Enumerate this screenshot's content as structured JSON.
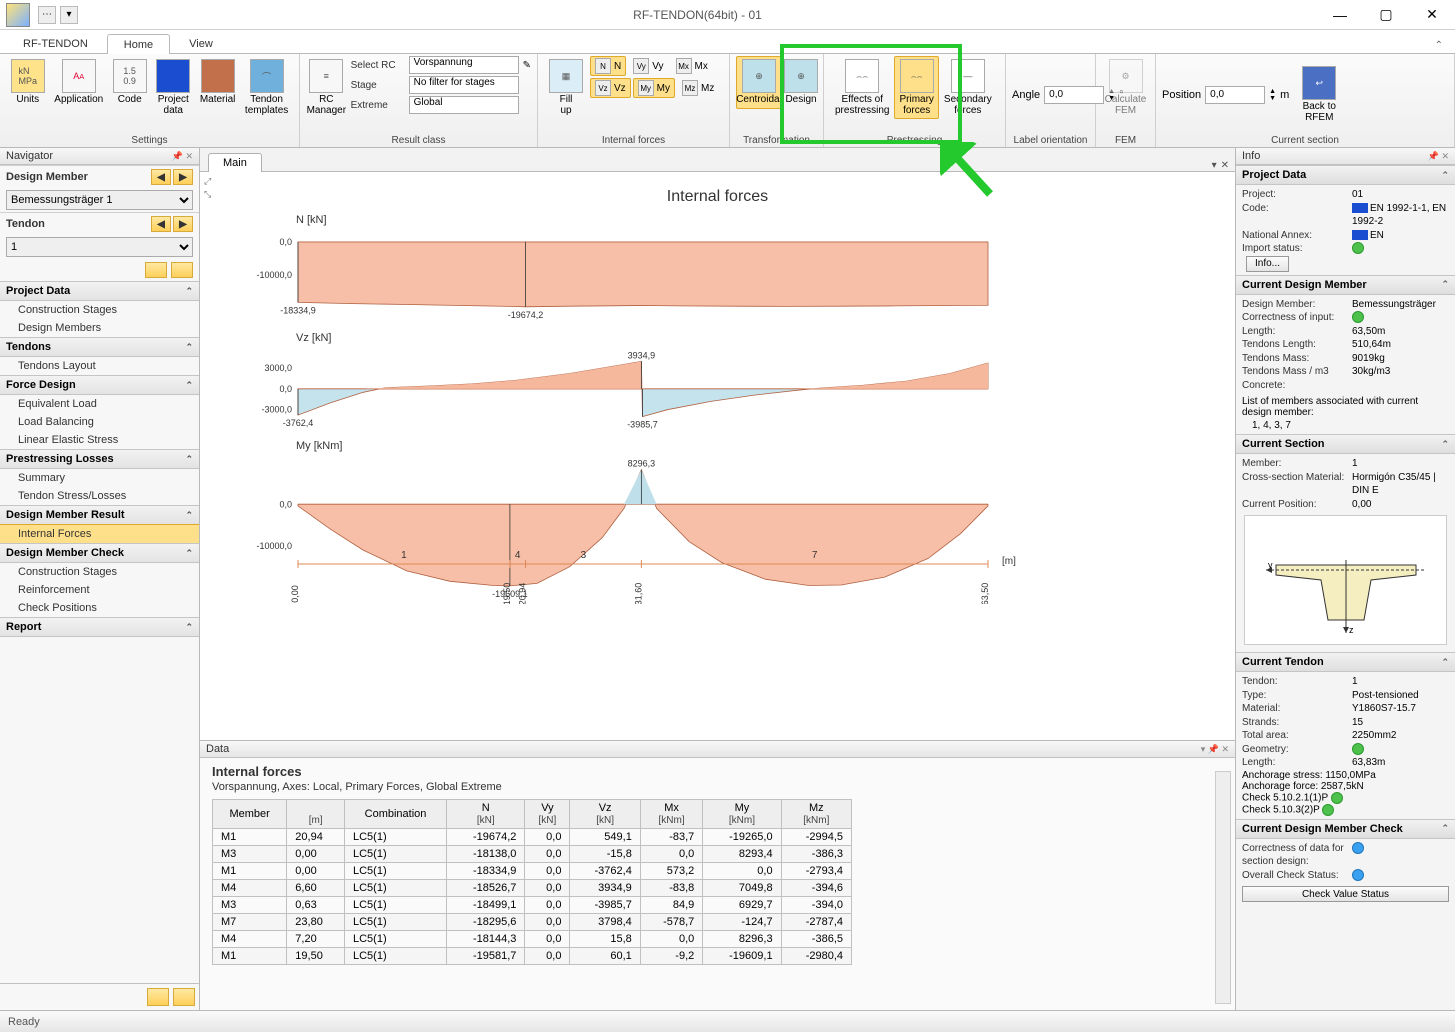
{
  "window": {
    "title": "RF-TENDON(64bit) - 01"
  },
  "tabs": {
    "context": "RF-TENDON",
    "items": [
      "Home",
      "View"
    ],
    "active": 0
  },
  "ribbon": {
    "settings": {
      "label": "Settings",
      "items": [
        {
          "name": "units",
          "label": "Units"
        },
        {
          "name": "application",
          "label": "Application"
        },
        {
          "name": "code",
          "label": "Code"
        },
        {
          "name": "project-data",
          "label": "Project\ndata"
        },
        {
          "name": "material",
          "label": "Material"
        },
        {
          "name": "tendon-templates",
          "label": "Tendon\ntemplates"
        }
      ]
    },
    "resultclass": {
      "label": "Result class",
      "rc_manager": "RC\nManager",
      "selectrc_label": "Select RC",
      "selectrc_value": "Vorspannung",
      "stage_label": "Stage",
      "stage_value": "No filter for stages",
      "extreme_label": "Extreme",
      "extreme_value": "Global"
    },
    "internalforces": {
      "label": "Internal forces",
      "fillup": "Fill\nup",
      "N": "N",
      "Vy": "Vy",
      "Mx": "Mx",
      "Vz": "Vz",
      "My": "My",
      "Mz": "Mz"
    },
    "transformation": {
      "label": "Transformation",
      "centroidal": "Centroidal",
      "design": "Design"
    },
    "prestressing": {
      "label": "Prestressing",
      "eff": "Effects of\nprestressing",
      "primary": "Primary\nforces",
      "secondary": "Secondary\nforces"
    },
    "labelorient": {
      "label": "Label orientation",
      "angle_label": "Angle",
      "angle_value": "0,0",
      "unit": "°"
    },
    "fem": {
      "label": "FEM",
      "calc": "Calculate\nFEM"
    },
    "currentsection": {
      "label": "Current section",
      "pos_label": "Position",
      "pos_value": "0,0",
      "unit": "m",
      "back": "Back to\nRFEM"
    }
  },
  "navigator": {
    "title": "Navigator",
    "design_member_label": "Design Member",
    "design_member_value": "Bemessungsträger 1",
    "tendon_label": "Tendon",
    "tendon_value": "1",
    "sections": [
      {
        "title": "Project Data",
        "items": [
          "Construction Stages",
          "Design Members"
        ]
      },
      {
        "title": "Tendons",
        "items": [
          "Tendons Layout"
        ]
      },
      {
        "title": "Force Design",
        "items": [
          "Equivalent Load",
          "Load Balancing",
          "Linear Elastic Stress"
        ]
      },
      {
        "title": "Prestressing Losses",
        "items": [
          "Summary",
          "Tendon Stress/Losses"
        ]
      },
      {
        "title": "Design Member Result",
        "items": [
          "Internal Forces"
        ],
        "selectedIndex": 0
      },
      {
        "title": "Design Member Check",
        "items": [
          "Construction Stages",
          "Reinforcement",
          "Check Positions"
        ]
      },
      {
        "title": "Report",
        "items": []
      }
    ]
  },
  "main_tab": "Main",
  "chart_data": [
    {
      "type": "area",
      "title": "N [kN]",
      "xrange": [
        0,
        63.5
      ],
      "yticks": [
        0,
        -10000
      ],
      "color": "#f6b89d",
      "annotations": [
        {
          "x": 0.0,
          "y": -18334.9,
          "text": "-18334,9"
        },
        {
          "x": 20.94,
          "y": -19674.2,
          "text": "-19674,2"
        }
      ],
      "series": [
        [
          0,
          -18335
        ],
        [
          5,
          -18700
        ],
        [
          10,
          -19000
        ],
        [
          15,
          -19300
        ],
        [
          20,
          -19600
        ],
        [
          20.94,
          -19674.2
        ],
        [
          25,
          -19500
        ],
        [
          30,
          -19350
        ],
        [
          31.6,
          -19300
        ],
        [
          35,
          -19400
        ],
        [
          40,
          -19500
        ],
        [
          45,
          -19550
        ],
        [
          50,
          -19500
        ],
        [
          55,
          -19400
        ],
        [
          60,
          -19300
        ],
        [
          63.5,
          -19250
        ]
      ]
    },
    {
      "type": "area",
      "title": "Vz [kN]",
      "xrange": [
        0,
        63.5
      ],
      "yticks": [
        -3000,
        0,
        3000
      ],
      "color_pos": "#f6b89d",
      "color_neg": "#bfe0eb",
      "annotations": [
        {
          "x": 0.0,
          "y": -3762.4,
          "text": "-3762,4"
        },
        {
          "x": 31.6,
          "y": 3934.9,
          "text": "3934,9"
        },
        {
          "x": 31.7,
          "y": -3985.7,
          "text": "-3985,7"
        }
      ],
      "series": [
        [
          0,
          -3762.4
        ],
        [
          3,
          -2000
        ],
        [
          6,
          -500
        ],
        [
          8,
          150
        ],
        [
          12,
          400
        ],
        [
          16,
          700
        ],
        [
          20,
          1200
        ],
        [
          25,
          2200
        ],
        [
          30,
          3500
        ],
        [
          31.6,
          3934.9
        ],
        [
          31.7,
          -3985.7
        ],
        [
          34,
          -3000
        ],
        [
          38,
          -1800
        ],
        [
          42,
          -900
        ],
        [
          46,
          -200
        ],
        [
          48,
          100
        ],
        [
          52,
          500
        ],
        [
          56,
          1100
        ],
        [
          60,
          2200
        ],
        [
          63.5,
          3700
        ]
      ]
    },
    {
      "type": "area",
      "title": "My [kNm]",
      "xrange": [
        0,
        63.5
      ],
      "yticks": [
        0,
        -10000
      ],
      "color_pos": "#bfe0eb",
      "color_neg": "#f6b89d",
      "annotations": [
        {
          "x": 19.5,
          "y": -19609.1,
          "text": "-19609,1"
        },
        {
          "x": 31.6,
          "y": 8296.3,
          "text": "8296,3"
        }
      ],
      "series": [
        [
          0,
          -400
        ],
        [
          3,
          -6000
        ],
        [
          6,
          -11000
        ],
        [
          10,
          -16000
        ],
        [
          14,
          -18500
        ],
        [
          18,
          -19500
        ],
        [
          19.5,
          -19609.1
        ],
        [
          22,
          -19000
        ],
        [
          25,
          -15000
        ],
        [
          28,
          -8000
        ],
        [
          30,
          -1000
        ],
        [
          31.6,
          8296.3
        ],
        [
          33,
          -1000
        ],
        [
          36,
          -9000
        ],
        [
          39,
          -14000
        ],
        [
          43,
          -18000
        ],
        [
          47,
          -19500
        ],
        [
          50,
          -19400
        ],
        [
          54,
          -17500
        ],
        [
          58,
          -13000
        ],
        [
          61,
          -7000
        ],
        [
          63.5,
          -400
        ]
      ],
      "x_marks": [
        {
          "pos": 0.0,
          "label": "0,00"
        },
        {
          "pos": 19.5,
          "label": "19,50"
        },
        {
          "pos": 20.94,
          "label": "20,94"
        },
        {
          "pos": 31.6,
          "label": "31,60"
        },
        {
          "pos": 63.5,
          "label": "63,50"
        }
      ],
      "segment_labels": [
        "1",
        "4",
        "3",
        "7"
      ],
      "xunit": "[m]"
    }
  ],
  "data_panel": {
    "header": "Data",
    "title": "Internal forces",
    "subtitle": "Vorspannung, Axes: Local, Primary Forces, Global Extreme",
    "columns": [
      {
        "h1": "Member",
        "h2": ""
      },
      {
        "h1": "",
        "h2": "[m]"
      },
      {
        "h1": "Combination",
        "h2": ""
      },
      {
        "h1": "N",
        "h2": "[kN]"
      },
      {
        "h1": "Vy",
        "h2": "[kN]"
      },
      {
        "h1": "Vz",
        "h2": "[kN]"
      },
      {
        "h1": "Mx",
        "h2": "[kNm]"
      },
      {
        "h1": "My",
        "h2": "[kNm]"
      },
      {
        "h1": "Mz",
        "h2": "[kNm]"
      }
    ],
    "rows": [
      [
        "M1",
        "20,94",
        "LC5(1)",
        "-19674,2",
        "0,0",
        "549,1",
        "-83,7",
        "-19265,0",
        "-2994,5"
      ],
      [
        "M3",
        "0,00",
        "LC5(1)",
        "-18138,0",
        "0,0",
        "-15,8",
        "0,0",
        "8293,4",
        "-386,3"
      ],
      [
        "M1",
        "0,00",
        "LC5(1)",
        "-18334,9",
        "0,0",
        "-3762,4",
        "573,2",
        "0,0",
        "-2793,4"
      ],
      [
        "M4",
        "6,60",
        "LC5(1)",
        "-18526,7",
        "0,0",
        "3934,9",
        "-83,8",
        "7049,8",
        "-394,6"
      ],
      [
        "M3",
        "0,63",
        "LC5(1)",
        "-18499,1",
        "0,0",
        "-3985,7",
        "84,9",
        "6929,7",
        "-394,0"
      ],
      [
        "M7",
        "23,80",
        "LC5(1)",
        "-18295,6",
        "0,0",
        "3798,4",
        "-578,7",
        "-124,7",
        "-2787,4"
      ],
      [
        "M4",
        "7,20",
        "LC5(1)",
        "-18144,3",
        "0,0",
        "15,8",
        "0,0",
        "8296,3",
        "-386,5"
      ],
      [
        "M1",
        "19,50",
        "LC5(1)",
        "-19581,7",
        "0,0",
        "60,1",
        "-9,2",
        "-19609,1",
        "-2980,4"
      ]
    ]
  },
  "info": {
    "title": "Info",
    "project_data": {
      "title": "Project Data",
      "rows": [
        [
          "Project:",
          "01"
        ],
        [
          "Code:",
          "EN 1992-1-1, EN 1992-2"
        ],
        [
          "National Annex:",
          "EN"
        ],
        [
          "Import status:",
          "ok"
        ]
      ],
      "info_btn": "Info..."
    },
    "current_dm": {
      "title": "Current Design Member",
      "rows": [
        [
          "Design Member:",
          "Bemessungsträger"
        ],
        [
          "Correctness of input:",
          "ok"
        ],
        [
          "Length:",
          "63,50m"
        ],
        [
          "Tendons Length:",
          "510,64m"
        ],
        [
          "Tendons Mass:",
          "9019kg"
        ],
        [
          "Tendons Mass / m3 Concrete:",
          "30kg/m3"
        ]
      ],
      "note1": "List of members associated with current design member:",
      "members": "1, 4, 3, 7"
    },
    "current_section": {
      "title": "Current Section",
      "rows": [
        [
          "Member:",
          "1"
        ],
        [
          "Cross-section Material:",
          "Hormigón C35/45 | DIN E"
        ],
        [
          "Current Position:",
          "0,00"
        ]
      ]
    },
    "current_tendon": {
      "title": "Current Tendon",
      "rows": [
        [
          "Tendon:",
          "1"
        ],
        [
          "Type:",
          "Post-tensioned"
        ],
        [
          "Material:",
          "Y1860S7-15.7"
        ],
        [
          "Strands:",
          "15"
        ],
        [
          "Total area:",
          "2250mm2"
        ],
        [
          "Geometry:",
          "ok"
        ],
        [
          "Length:",
          "63,83m"
        ]
      ],
      "extras": [
        "Anchorage stress: 1150,0MPa",
        "Anchorage force: 2587,5kN",
        "Check 5.10.2.1(1)P",
        "Check 5.10.3(2)P"
      ]
    },
    "current_dmc": {
      "title": "Current Design Member Check",
      "rows": [
        [
          "Correctness of data for section design:",
          "info"
        ],
        [
          "Overall Check Status:",
          "info"
        ]
      ],
      "btn": "Check Value Status"
    }
  },
  "status": "Ready"
}
